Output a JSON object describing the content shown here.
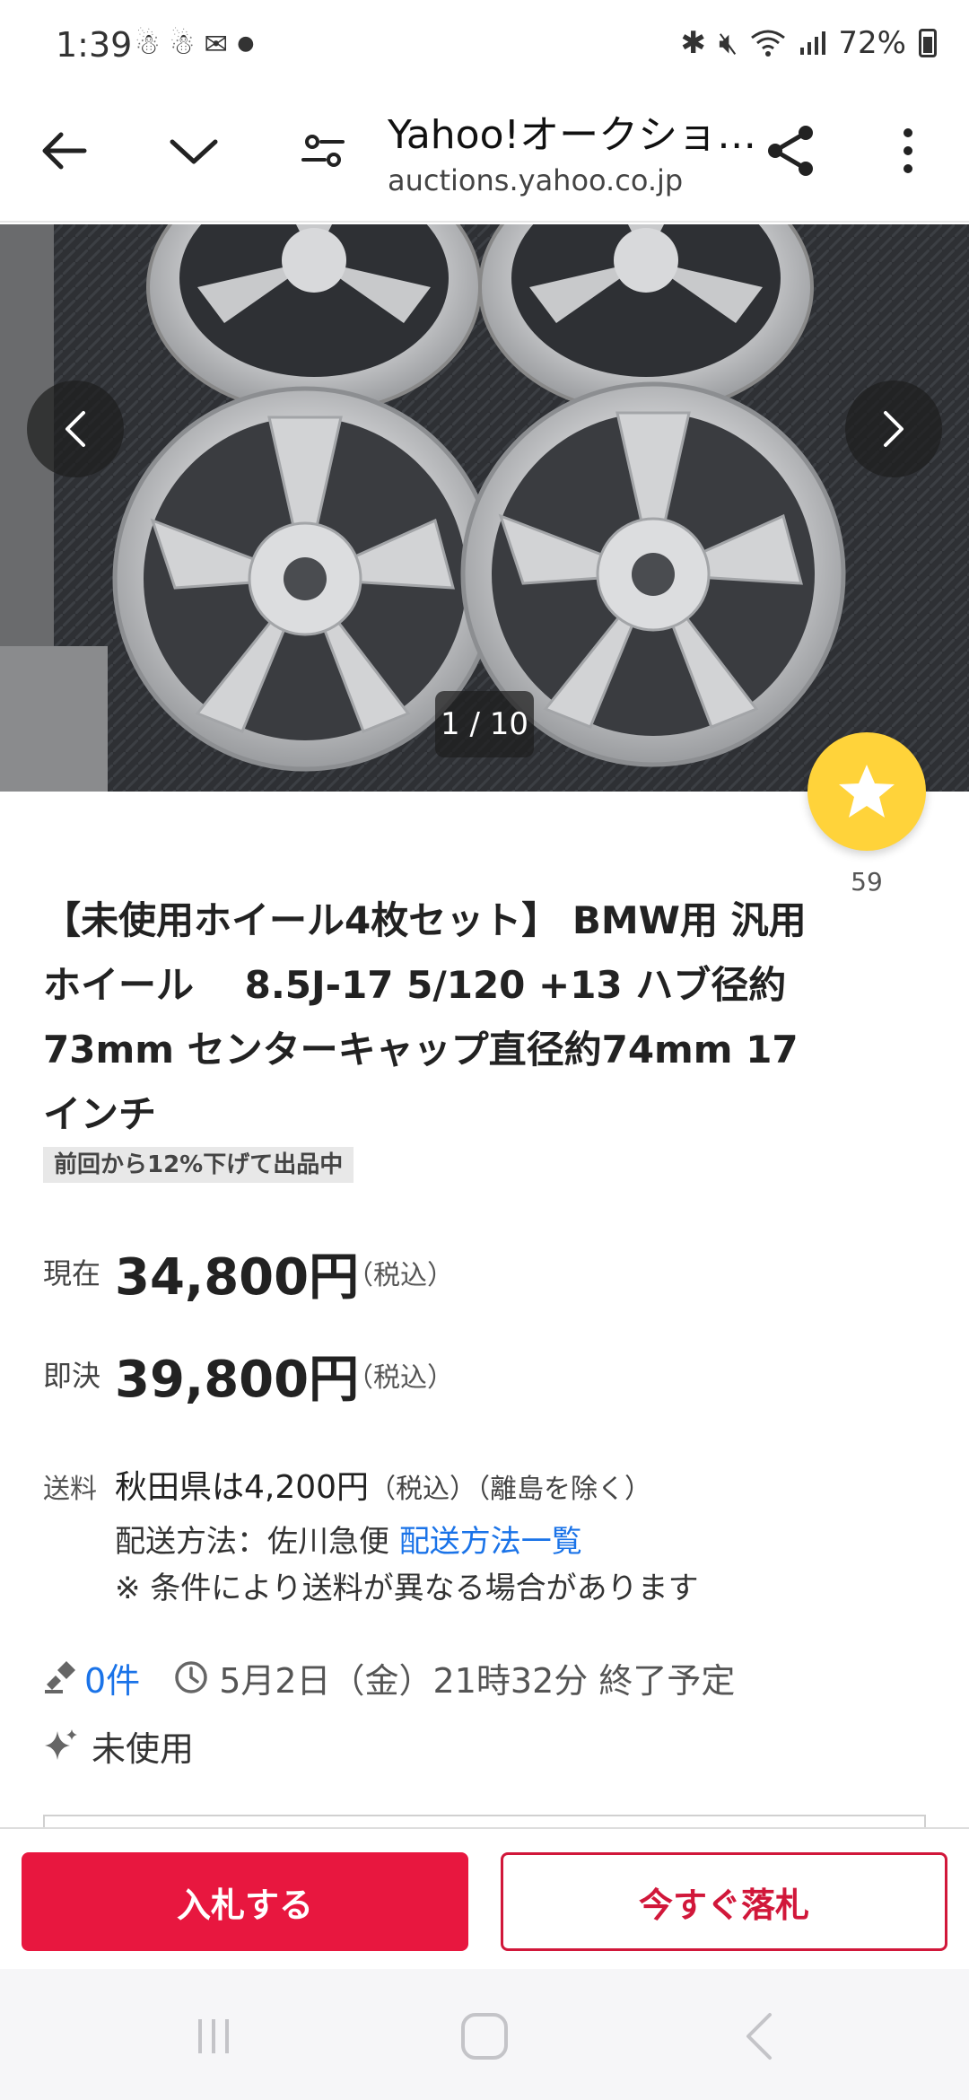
{
  "status_bar": {
    "time": "1:39",
    "battery_percent": "72%",
    "left_icons": [
      "notification-icon",
      "notification-icon",
      "message-icon",
      "dot"
    ],
    "right_icons": [
      "bluetooth-icon",
      "mute-icon",
      "wifi-icon",
      "signal-icon",
      "battery-icon"
    ]
  },
  "browser": {
    "title": "Yahoo!オークショ…",
    "url": "auctions.yahoo.co.jp"
  },
  "carousel": {
    "counter": "1 / 10"
  },
  "watch": {
    "count": "59"
  },
  "item": {
    "title": "【未使用ホイール4枚セット】 BMW用 汎用ホイール　 8.5J-17 5/120 +13 ハブ径約73mm センターキャップ直径約74mm 17インチ",
    "relist_badge": "前回から12%下げて出品中"
  },
  "prices": {
    "current_label": "現在",
    "current_value": "34,800円",
    "current_tax": "（税込）",
    "buynow_label": "即決",
    "buynow_value": "39,800円",
    "buynow_tax": "（税込）"
  },
  "shipping": {
    "label": "送料",
    "cost": "秋田県は4,200円",
    "cost_tax": "（税込）",
    "cost_note": "（離島を除く）",
    "method_prefix": "配送方法：佐川急便",
    "method_link": "配送方法一覧",
    "note": "※ 条件により送料が異なる場合があります"
  },
  "bids": {
    "count": "0件",
    "end_time": "5月2日（金）21時32分 終了予定"
  },
  "condition": {
    "text": "未使用"
  },
  "actions": {
    "bid_label": "入札する",
    "buynow_label": "今すぐ落札"
  },
  "colors": {
    "brand_red": "#e8173f",
    "link_blue": "#1a73e8",
    "star_yellow": "#ffd33a"
  }
}
